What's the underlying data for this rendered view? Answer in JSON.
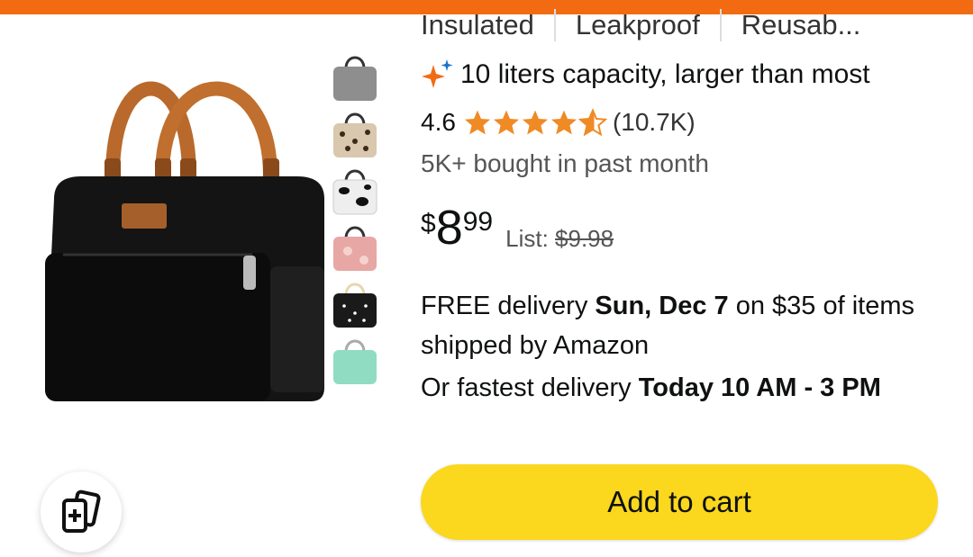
{
  "product": {
    "feature_chips": [
      "Insulated",
      "Leakproof",
      "Reusab..."
    ],
    "feature_highlight": "10 liters capacity, larger than most",
    "rating_value": "4.6",
    "stars": 4.6,
    "review_count": "(10.7K)",
    "bought_text": "5K+ bought in past month",
    "price": {
      "currency": "$",
      "whole": "8",
      "fraction": "99"
    },
    "list_label": "List:",
    "list_price": "$9.98",
    "delivery": {
      "prefix": "FREE delivery ",
      "date": "Sun, Dec 7",
      "suffix": " on $35 of items shipped by Amazon"
    },
    "fastest": {
      "prefix": "Or fastest delivery ",
      "window": "Today 10 AM - 3 PM"
    },
    "add_to_cart_label": "Add to cart"
  },
  "gallery": {
    "main_image": "black-lunch-bag-photo",
    "thumbnails": [
      {
        "icon": "gray-bag-thumbnail",
        "color": "#8e8e8e"
      },
      {
        "icon": "leopard-bag-thumbnail",
        "color": "#d9c7ae"
      },
      {
        "icon": "cow-print-bag-thumbnail",
        "color": "#eeeeee"
      },
      {
        "icon": "pink-floral-bag-thumbnail",
        "color": "#e7a7a4"
      },
      {
        "icon": "black-dot-bag-thumbnail",
        "color": "#1a1a1a"
      },
      {
        "icon": "mint-bag-thumbnail",
        "color": "#8fdcc3"
      }
    ]
  },
  "colors": {
    "top_bar": "#f26b12",
    "cart_button": "#fbd71d",
    "star": "#f08a24"
  }
}
